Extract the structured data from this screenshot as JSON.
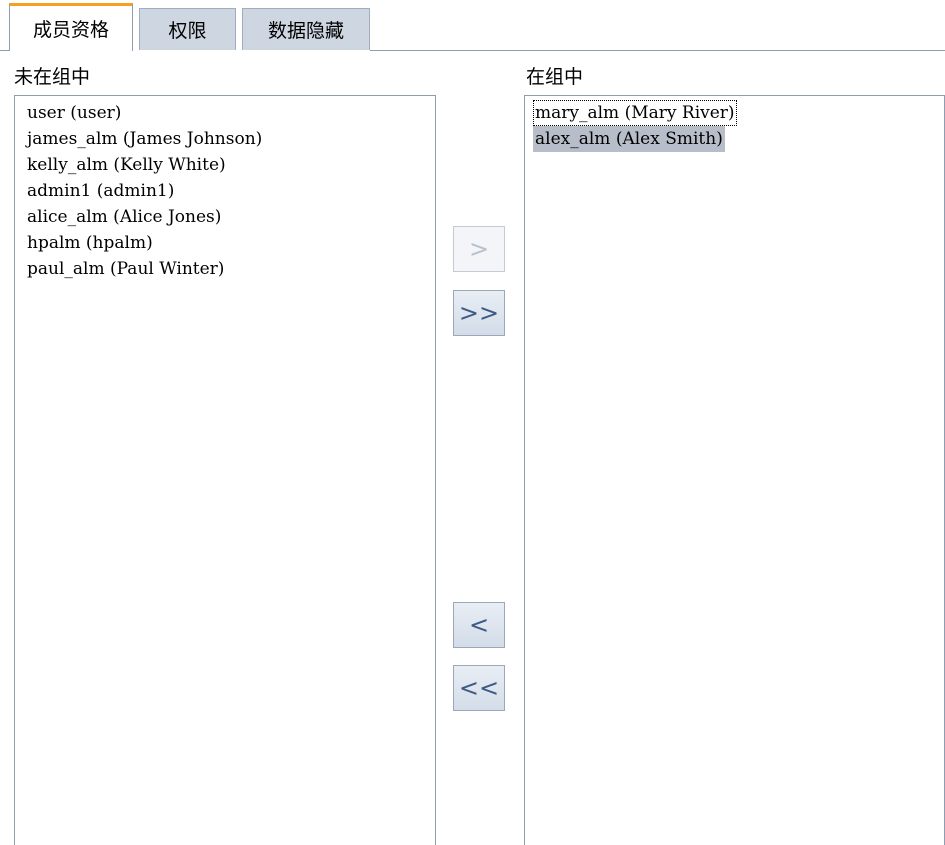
{
  "tabs": [
    {
      "label": "成员资格",
      "active": true
    },
    {
      "label": "权限",
      "active": false
    },
    {
      "label": "数据隐藏",
      "active": false
    }
  ],
  "not_in_group": {
    "label": "未在组中",
    "items": [
      "user (user)",
      "james_alm (James Johnson)",
      "kelly_alm (Kelly White)",
      "admin1 (admin1)",
      "alice_alm (Alice Jones)",
      "hpalm (hpalm)",
      "paul_alm (Paul Winter)"
    ]
  },
  "in_group": {
    "label": "在组中",
    "items": [
      "mary_alm (Mary River)",
      "alex_alm (Alex Smith)"
    ],
    "selected_item": "alex_alm (Alex Smith)",
    "focused_item": "mary_alm (Mary River)"
  },
  "buttons": {
    "add_selected": ">",
    "add_all": ">>",
    "remove_selected": "<",
    "remove_all": "<<"
  }
}
